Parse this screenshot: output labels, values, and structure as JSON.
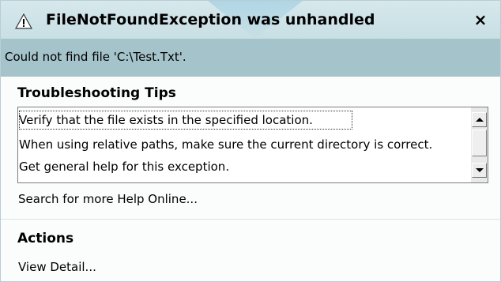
{
  "dialog": {
    "title": "FileNotFoundException was unhandled",
    "close_label": "×",
    "message": "Could not find file 'C:\\Test.Txt'."
  },
  "troubleshooting": {
    "heading": "Troubleshooting Tips",
    "tips": [
      "Verify that the file exists in the specified location.",
      "When using relative paths, make sure the current directory is correct.",
      "Get general help for this exception."
    ]
  },
  "search_link": "Search for more Help Online...",
  "actions": {
    "heading": "Actions",
    "view_detail": "View Detail..."
  },
  "icons": {
    "title_icon": "warning-triangle-icon",
    "close_icon": "close-icon",
    "scroll_up_icon": "arrow-up-icon",
    "scroll_down_icon": "arrow-down-icon"
  },
  "colors": {
    "titlebar": "#cfe3e8",
    "message_bar": "#a5c3ca",
    "background": "#fbfcfc"
  }
}
